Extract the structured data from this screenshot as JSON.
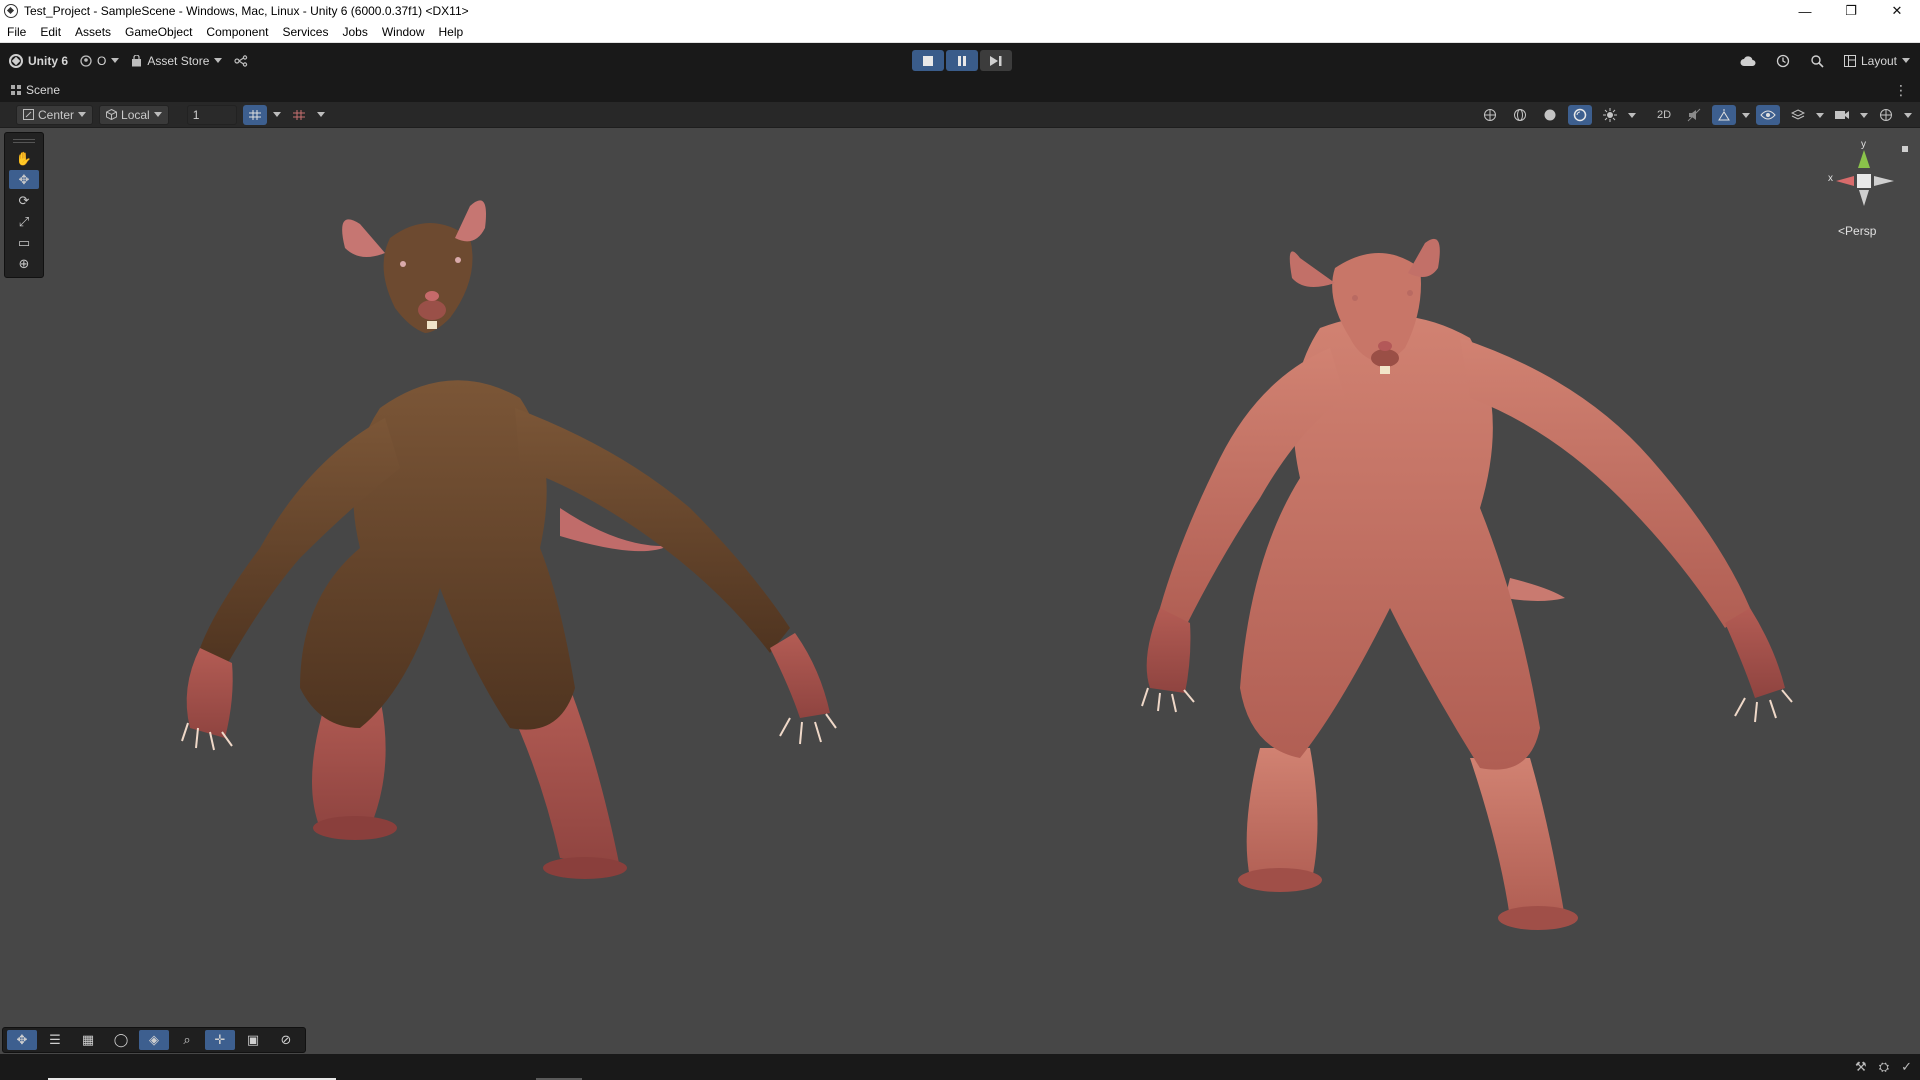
{
  "window": {
    "title": "Test_Project - SampleScene - Windows, Mac, Linux - Unity 6 (6000.0.37f1) <DX11>",
    "controls": [
      "—",
      "❐",
      "✕"
    ]
  },
  "menu": [
    "File",
    "Edit",
    "Assets",
    "GameObject",
    "Component",
    "Services",
    "Jobs",
    "Window",
    "Help"
  ],
  "toolbar": {
    "unity_label": "Unity 6",
    "account_label": "O",
    "asset_store_label": "Asset Store",
    "layout_label": "Layout"
  },
  "scene_tab": {
    "label": "Scene"
  },
  "scene_toolbar": {
    "pivot_label": "Center",
    "space_label": "Local",
    "grid_value": "1"
  },
  "gizmo": {
    "axis_y": "y",
    "axis_x": "x",
    "projection_label": "Persp"
  },
  "colors": {
    "accent": "#3d5f8f",
    "viewport": "#474747",
    "fur": "#6a4a30",
    "skin": "#c06a5e"
  }
}
